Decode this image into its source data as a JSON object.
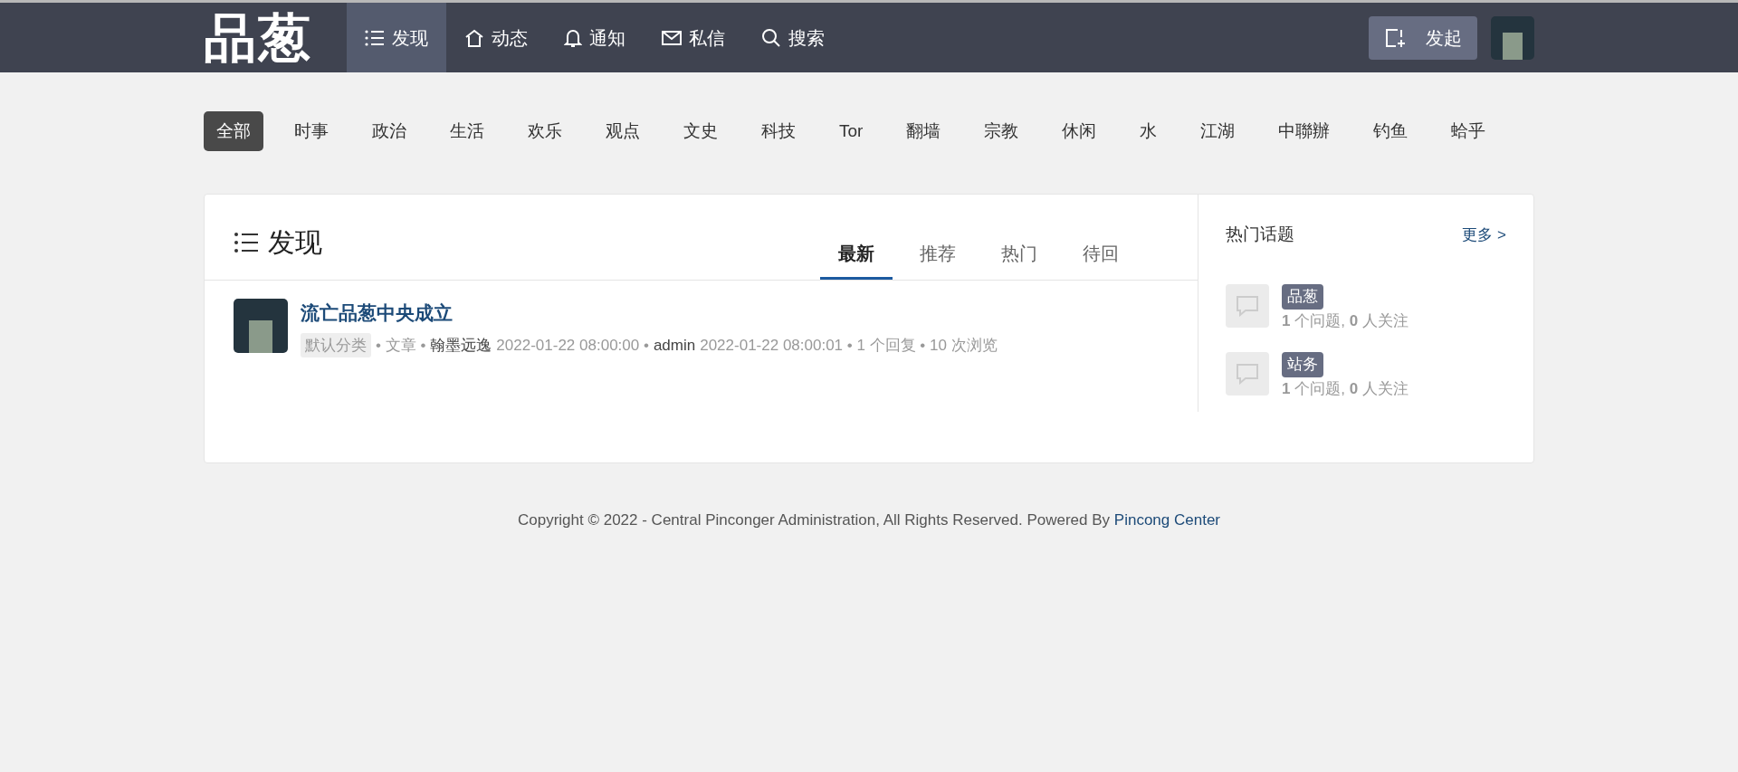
{
  "header": {
    "logo": "品葱",
    "nav": [
      {
        "label": "发现",
        "selected": true
      },
      {
        "label": "动态",
        "selected": false
      },
      {
        "label": "通知",
        "selected": false
      },
      {
        "label": "私信",
        "selected": false
      },
      {
        "label": "搜索",
        "selected": false
      }
    ],
    "publish_button": "发起"
  },
  "categories": [
    {
      "label": "全部",
      "selected": true
    },
    {
      "label": "时事",
      "selected": false
    },
    {
      "label": "政治",
      "selected": false
    },
    {
      "label": "生活",
      "selected": false
    },
    {
      "label": "欢乐",
      "selected": false
    },
    {
      "label": "观点",
      "selected": false
    },
    {
      "label": "文史",
      "selected": false
    },
    {
      "label": "科技",
      "selected": false
    },
    {
      "label": "Tor",
      "selected": false
    },
    {
      "label": "翻墙",
      "selected": false
    },
    {
      "label": "宗教",
      "selected": false
    },
    {
      "label": "休闲",
      "selected": false
    },
    {
      "label": "水",
      "selected": false
    },
    {
      "label": "江湖",
      "selected": false
    },
    {
      "label": "中聯辦",
      "selected": false
    },
    {
      "label": "钓鱼",
      "selected": false
    },
    {
      "label": "蛤乎",
      "selected": false
    }
  ],
  "main": {
    "title": "发现",
    "tabs": [
      {
        "label": "最新",
        "selected": true
      },
      {
        "label": "推荐",
        "selected": false
      },
      {
        "label": "热门",
        "selected": false
      },
      {
        "label": "待回",
        "selected": false
      }
    ],
    "posts": [
      {
        "title": "流亡品葱中央成立",
        "category": "默认分类",
        "meta": [
          {
            "kind": "plain",
            "text": "• 文章 •"
          },
          {
            "kind": "user",
            "text": "翰墨远逸"
          },
          {
            "kind": "plain",
            "text": "2022-01-22 08:00:00 •"
          },
          {
            "kind": "user",
            "text": "admin"
          },
          {
            "kind": "plain",
            "text": "2022-01-22 08:00:01 • 1 个回复 • 10 次浏览"
          }
        ]
      }
    ]
  },
  "sidebar": {
    "title": "热门话题",
    "more_link": "更多 >",
    "topics": [
      {
        "tag": "品葱",
        "stats": "**1** 个问题, **0** 人关注"
      },
      {
        "tag": "站务",
        "stats": "**1** 个问题, **0** 人关注"
      }
    ]
  },
  "footer": {
    "text": "Copyright © 2022 - Central Pinconger Administration, All Rights Reserved. Powered By",
    "link": "Pincong Center"
  }
}
